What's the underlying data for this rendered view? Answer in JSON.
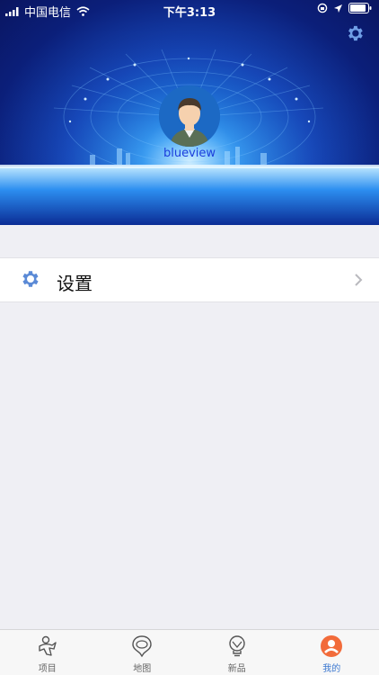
{
  "status_bar": {
    "carrier": "中国电信",
    "time": "下午3:13"
  },
  "profile": {
    "username": "blueview"
  },
  "menu": {
    "settings_label": "设置"
  },
  "tabs": [
    {
      "label": "项目",
      "icon": "project-icon"
    },
    {
      "label": "地图",
      "icon": "map-pin-icon"
    },
    {
      "label": "新品",
      "icon": "bulb-icon"
    },
    {
      "label": "我的",
      "icon": "profile-icon",
      "active": true
    }
  ],
  "colors": {
    "accent": "#3c78d0",
    "active_tab": "#f26b3a",
    "gear": "#5b8ad6"
  }
}
